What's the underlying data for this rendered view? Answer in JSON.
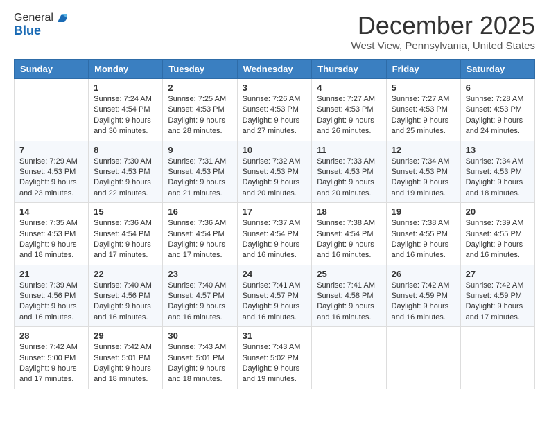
{
  "header": {
    "logo_line1": "General",
    "logo_line2": "Blue",
    "month_title": "December 2025",
    "location": "West View, Pennsylvania, United States"
  },
  "weekdays": [
    "Sunday",
    "Monday",
    "Tuesday",
    "Wednesday",
    "Thursday",
    "Friday",
    "Saturday"
  ],
  "weeks": [
    [
      {
        "day": "",
        "info": ""
      },
      {
        "day": "1",
        "info": "Sunrise: 7:24 AM\nSunset: 4:54 PM\nDaylight: 9 hours\nand 30 minutes."
      },
      {
        "day": "2",
        "info": "Sunrise: 7:25 AM\nSunset: 4:53 PM\nDaylight: 9 hours\nand 28 minutes."
      },
      {
        "day": "3",
        "info": "Sunrise: 7:26 AM\nSunset: 4:53 PM\nDaylight: 9 hours\nand 27 minutes."
      },
      {
        "day": "4",
        "info": "Sunrise: 7:27 AM\nSunset: 4:53 PM\nDaylight: 9 hours\nand 26 minutes."
      },
      {
        "day": "5",
        "info": "Sunrise: 7:27 AM\nSunset: 4:53 PM\nDaylight: 9 hours\nand 25 minutes."
      },
      {
        "day": "6",
        "info": "Sunrise: 7:28 AM\nSunset: 4:53 PM\nDaylight: 9 hours\nand 24 minutes."
      }
    ],
    [
      {
        "day": "7",
        "info": "Sunrise: 7:29 AM\nSunset: 4:53 PM\nDaylight: 9 hours\nand 23 minutes."
      },
      {
        "day": "8",
        "info": "Sunrise: 7:30 AM\nSunset: 4:53 PM\nDaylight: 9 hours\nand 22 minutes."
      },
      {
        "day": "9",
        "info": "Sunrise: 7:31 AM\nSunset: 4:53 PM\nDaylight: 9 hours\nand 21 minutes."
      },
      {
        "day": "10",
        "info": "Sunrise: 7:32 AM\nSunset: 4:53 PM\nDaylight: 9 hours\nand 20 minutes."
      },
      {
        "day": "11",
        "info": "Sunrise: 7:33 AM\nSunset: 4:53 PM\nDaylight: 9 hours\nand 20 minutes."
      },
      {
        "day": "12",
        "info": "Sunrise: 7:34 AM\nSunset: 4:53 PM\nDaylight: 9 hours\nand 19 minutes."
      },
      {
        "day": "13",
        "info": "Sunrise: 7:34 AM\nSunset: 4:53 PM\nDaylight: 9 hours\nand 18 minutes."
      }
    ],
    [
      {
        "day": "14",
        "info": "Sunrise: 7:35 AM\nSunset: 4:53 PM\nDaylight: 9 hours\nand 18 minutes."
      },
      {
        "day": "15",
        "info": "Sunrise: 7:36 AM\nSunset: 4:54 PM\nDaylight: 9 hours\nand 17 minutes."
      },
      {
        "day": "16",
        "info": "Sunrise: 7:36 AM\nSunset: 4:54 PM\nDaylight: 9 hours\nand 17 minutes."
      },
      {
        "day": "17",
        "info": "Sunrise: 7:37 AM\nSunset: 4:54 PM\nDaylight: 9 hours\nand 16 minutes."
      },
      {
        "day": "18",
        "info": "Sunrise: 7:38 AM\nSunset: 4:54 PM\nDaylight: 9 hours\nand 16 minutes."
      },
      {
        "day": "19",
        "info": "Sunrise: 7:38 AM\nSunset: 4:55 PM\nDaylight: 9 hours\nand 16 minutes."
      },
      {
        "day": "20",
        "info": "Sunrise: 7:39 AM\nSunset: 4:55 PM\nDaylight: 9 hours\nand 16 minutes."
      }
    ],
    [
      {
        "day": "21",
        "info": "Sunrise: 7:39 AM\nSunset: 4:56 PM\nDaylight: 9 hours\nand 16 minutes."
      },
      {
        "day": "22",
        "info": "Sunrise: 7:40 AM\nSunset: 4:56 PM\nDaylight: 9 hours\nand 16 minutes."
      },
      {
        "day": "23",
        "info": "Sunrise: 7:40 AM\nSunset: 4:57 PM\nDaylight: 9 hours\nand 16 minutes."
      },
      {
        "day": "24",
        "info": "Sunrise: 7:41 AM\nSunset: 4:57 PM\nDaylight: 9 hours\nand 16 minutes."
      },
      {
        "day": "25",
        "info": "Sunrise: 7:41 AM\nSunset: 4:58 PM\nDaylight: 9 hours\nand 16 minutes."
      },
      {
        "day": "26",
        "info": "Sunrise: 7:42 AM\nSunset: 4:59 PM\nDaylight: 9 hours\nand 16 minutes."
      },
      {
        "day": "27",
        "info": "Sunrise: 7:42 AM\nSunset: 4:59 PM\nDaylight: 9 hours\nand 17 minutes."
      }
    ],
    [
      {
        "day": "28",
        "info": "Sunrise: 7:42 AM\nSunset: 5:00 PM\nDaylight: 9 hours\nand 17 minutes."
      },
      {
        "day": "29",
        "info": "Sunrise: 7:42 AM\nSunset: 5:01 PM\nDaylight: 9 hours\nand 18 minutes."
      },
      {
        "day": "30",
        "info": "Sunrise: 7:43 AM\nSunset: 5:01 PM\nDaylight: 9 hours\nand 18 minutes."
      },
      {
        "day": "31",
        "info": "Sunrise: 7:43 AM\nSunset: 5:02 PM\nDaylight: 9 hours\nand 19 minutes."
      },
      {
        "day": "",
        "info": ""
      },
      {
        "day": "",
        "info": ""
      },
      {
        "day": "",
        "info": ""
      }
    ]
  ]
}
